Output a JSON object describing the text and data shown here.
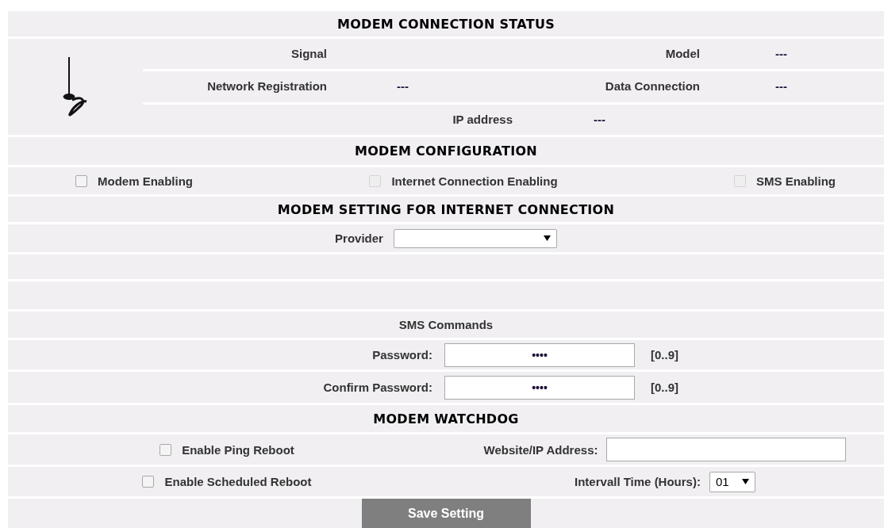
{
  "status": {
    "title": "MODEM CONNECTION STATUS",
    "rows": [
      {
        "cells": [
          {
            "label": "Signal"
          },
          {
            "label": "Model",
            "value": "---"
          }
        ]
      },
      {
        "cells": [
          {
            "label": "Network Registration",
            "value": "---"
          },
          {
            "label": "Data Connection",
            "value": "---"
          }
        ]
      },
      {
        "cells": [
          {
            "label": "IP address",
            "value": "---"
          }
        ]
      }
    ]
  },
  "configuration": {
    "title": "MODEM CONFIGURATION",
    "options": [
      {
        "label": "Modem Enabling",
        "checked": false,
        "disabled": false
      },
      {
        "label": "Internet Connection Enabling",
        "checked": false,
        "disabled": true
      },
      {
        "label": "SMS Enabling",
        "checked": false,
        "disabled": true
      }
    ]
  },
  "internet": {
    "title": "MODEM SETTING FOR INTERNET CONNECTION",
    "provider": {
      "label": "Provider"
    },
    "sms_commands": {
      "title": "SMS Commands",
      "fields": [
        {
          "label": "Password:",
          "value": "••••",
          "hint": "[0..9]"
        },
        {
          "label": "Confirm Password:",
          "value": "••••",
          "hint": "[0..9]"
        }
      ]
    }
  },
  "watchdog": {
    "title": "MODEM WATCHDOG",
    "rows": [
      {
        "option": {
          "label": "Enable Ping Reboot",
          "checked": false
        },
        "field": {
          "kind": "text",
          "label": "Website/IP Address:"
        }
      },
      {
        "option": {
          "label": "Enable Scheduled Reboot",
          "checked": false
        },
        "field": {
          "kind": "select",
          "label": "Intervall Time (Hours):",
          "value": "01"
        }
      }
    ]
  },
  "save_button": "Save Setting"
}
